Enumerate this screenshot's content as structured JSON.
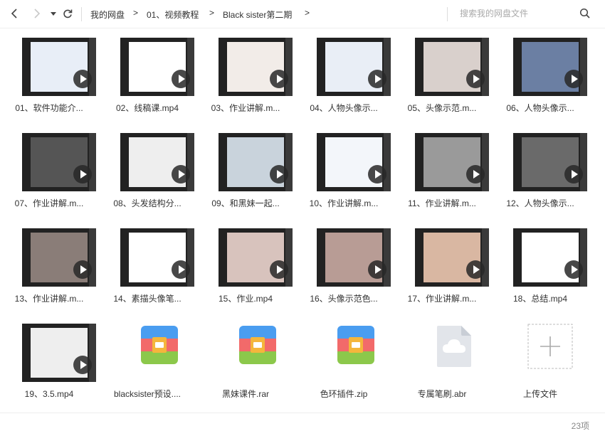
{
  "toolbar": {
    "back_icon": "chevron-left-icon",
    "forward_icon": "chevron-right-icon",
    "dropdown_icon": "caret-down-icon",
    "refresh_icon": "refresh-icon",
    "breadcrumb": [
      "我的网盘",
      "01、视频教程",
      "Black sister第二期"
    ],
    "crumb_separator": ">",
    "search_placeholder": "搜索我的网盘文件"
  },
  "files": [
    {
      "name": "01、软件功能介...",
      "kind": "video",
      "thumb": "#e8eef7"
    },
    {
      "name": "02、线稿课.mp4",
      "kind": "video",
      "thumb": "#ffffff"
    },
    {
      "name": "03、作业讲解.m...",
      "kind": "video",
      "thumb": "#f2ece8"
    },
    {
      "name": "04、人物头像示...",
      "kind": "video",
      "thumb": "#e9eef6"
    },
    {
      "name": "05、头像示范.m...",
      "kind": "video",
      "thumb": "#d9d0cc"
    },
    {
      "name": "06、人物头像示...",
      "kind": "video",
      "thumb": "#6b7fa3"
    },
    {
      "name": "07、作业讲解.m...",
      "kind": "video",
      "thumb": "#555555"
    },
    {
      "name": "08、头发结构分...",
      "kind": "video",
      "thumb": "#eeeeee"
    },
    {
      "name": "09、和黑妹一起...",
      "kind": "video",
      "thumb": "#c9d3dc"
    },
    {
      "name": "10、作业讲解.m...",
      "kind": "video",
      "thumb": "#f3f6fa"
    },
    {
      "name": "11、作业讲解.m...",
      "kind": "video",
      "thumb": "#9a9a9a"
    },
    {
      "name": "12、人物头像示...",
      "kind": "video",
      "thumb": "#6a6a6a"
    },
    {
      "name": "13、作业讲解.m...",
      "kind": "video",
      "thumb": "#8a7d78"
    },
    {
      "name": "14、素描头像笔...",
      "kind": "video",
      "thumb": "#ffffff"
    },
    {
      "name": "15、作业.mp4",
      "kind": "video",
      "thumb": "#d8c3bd"
    },
    {
      "name": "16、头像示范色...",
      "kind": "video",
      "thumb": "#b89c95"
    },
    {
      "name": "17、作业讲解.m...",
      "kind": "video",
      "thumb": "#d9b7a2"
    },
    {
      "name": "18、总结.mp4",
      "kind": "video",
      "thumb": "#ffffff"
    },
    {
      "name": "19、3.5.mp4",
      "kind": "video",
      "thumb": "#eeeeee"
    },
    {
      "name": "blacksister预设....",
      "kind": "archive"
    },
    {
      "name": "黑妹课件.rar",
      "kind": "archive"
    },
    {
      "name": "色环插件.zip",
      "kind": "archive"
    },
    {
      "name": "专属笔刷.abr",
      "kind": "cloud-file"
    },
    {
      "name": "上传文件",
      "kind": "upload"
    }
  ],
  "icons": {
    "play": "play-icon",
    "archive": "archive-icon",
    "cloud_file": "cloud-file-icon",
    "upload": "plus-icon",
    "search": "search-icon"
  },
  "colors": {
    "archive_blue": "#4a9df0",
    "archive_red": "#f26a6a",
    "archive_green": "#8cc84b",
    "archive_clasp": "#f4b63c"
  },
  "status": {
    "count": "23项"
  }
}
